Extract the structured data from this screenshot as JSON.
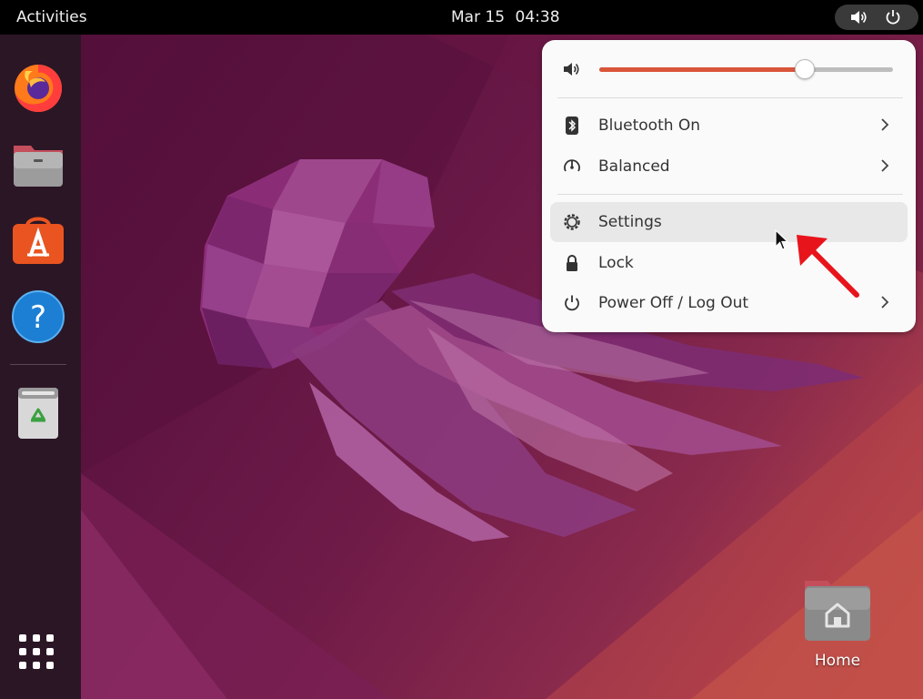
{
  "topbar": {
    "activities_label": "Activities",
    "date": "Mar 15",
    "time": "04:38",
    "tray_icons": [
      "volume-icon",
      "power-icon"
    ]
  },
  "dock": {
    "apps": [
      {
        "name": "Firefox",
        "icon": "firefox-icon"
      },
      {
        "name": "Files",
        "icon": "files-icon"
      },
      {
        "name": "Ubuntu Software",
        "icon": "software-icon"
      },
      {
        "name": "Help",
        "icon": "help-icon"
      },
      {
        "name": "Trash",
        "icon": "trash-icon"
      }
    ],
    "show_apps_icon": "grid-icon"
  },
  "quick_menu": {
    "volume": {
      "level": 0.7,
      "icon": "volume-icon"
    },
    "items": [
      {
        "label": "Bluetooth On",
        "icon": "bluetooth-icon",
        "has_submenu": true
      },
      {
        "label": "Balanced",
        "icon": "power-profile-icon",
        "has_submenu": true
      },
      {
        "label": "Settings",
        "icon": "gear-icon",
        "has_submenu": false,
        "highlighted": true
      },
      {
        "label": "Lock",
        "icon": "lock-icon",
        "has_submenu": false
      },
      {
        "label": "Power Off / Log Out",
        "icon": "power-icon",
        "has_submenu": true
      }
    ]
  },
  "desktop": {
    "home_folder_label": "Home"
  },
  "colors": {
    "accent": "#d9553a",
    "annotation_arrow": "#e8141c",
    "topbar": "#000000",
    "dock": "#2b1626"
  }
}
